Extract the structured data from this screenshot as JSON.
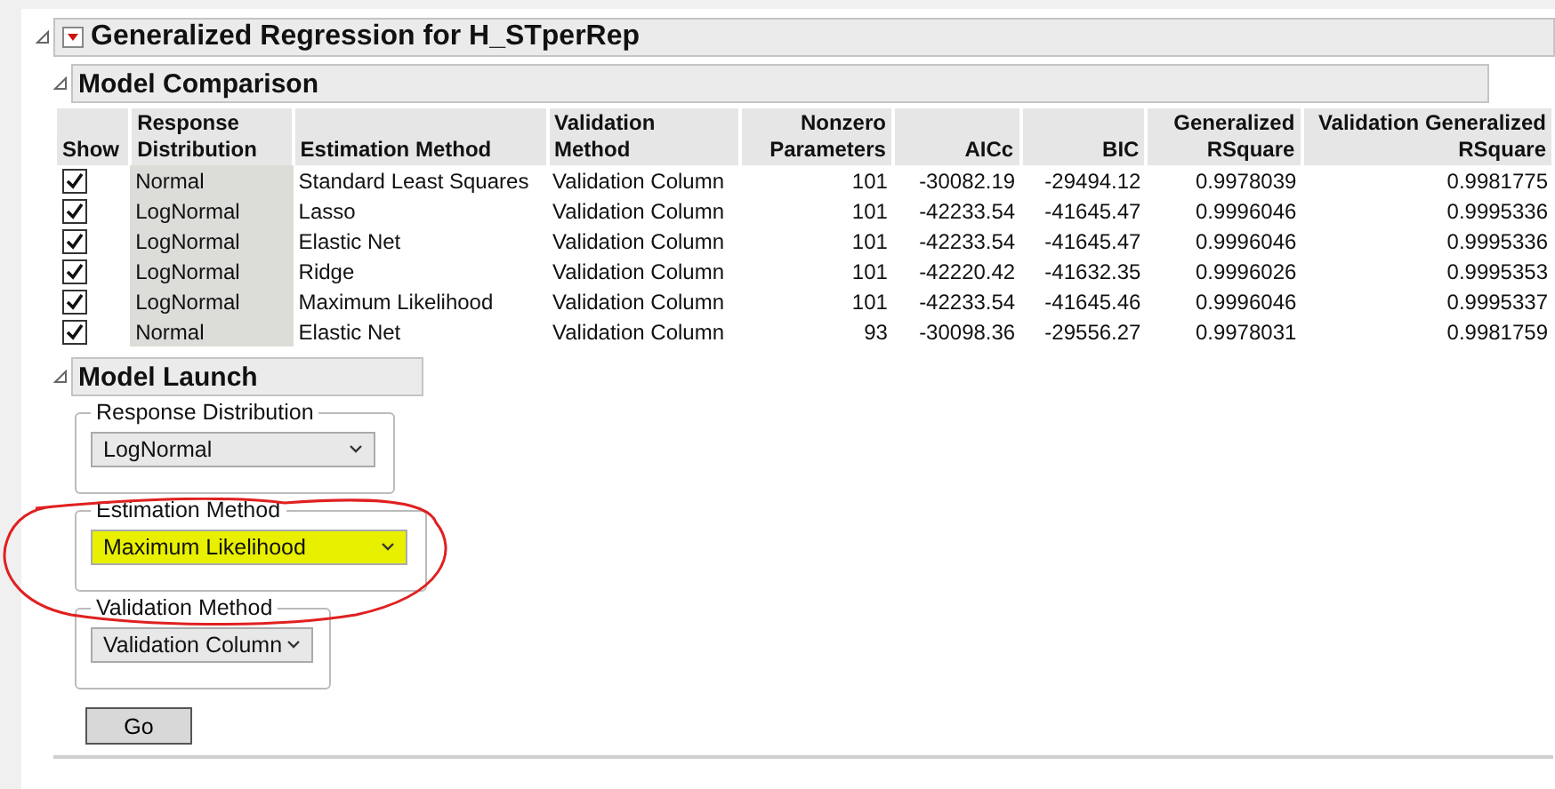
{
  "report": {
    "title": "Generalized Regression for H_STperRep"
  },
  "model_comparison": {
    "title": "Model Comparison",
    "show_header": "Show",
    "columns": [
      "Response Distribution",
      "Estimation Method",
      "Validation Method",
      "Nonzero Parameters",
      "AICc",
      "BIC",
      "Generalized RSquare",
      "Validation Generalized RSquare"
    ],
    "rows": [
      {
        "checked": true,
        "cells": [
          "Normal",
          "Standard Least Squares",
          "Validation Column",
          "101",
          "-30082.19",
          "-29494.12",
          "0.9978039",
          "0.9981775"
        ]
      },
      {
        "checked": true,
        "cells": [
          "LogNormal",
          "Lasso",
          "Validation Column",
          "101",
          "-42233.54",
          "-41645.47",
          "0.9996046",
          "0.9995336"
        ]
      },
      {
        "checked": true,
        "cells": [
          "LogNormal",
          "Elastic Net",
          "Validation Column",
          "101",
          "-42233.54",
          "-41645.47",
          "0.9996046",
          "0.9995336"
        ]
      },
      {
        "checked": true,
        "cells": [
          "LogNormal",
          "Ridge",
          "Validation Column",
          "101",
          "-42220.42",
          "-41632.35",
          "0.9996026",
          "0.9995353"
        ]
      },
      {
        "checked": true,
        "cells": [
          "LogNormal",
          "Maximum Likelihood",
          "Validation Column",
          "101",
          "-42233.54",
          "-41645.46",
          "0.9996046",
          "0.9995337"
        ]
      },
      {
        "checked": true,
        "cells": [
          "Normal",
          "Elastic Net",
          "Validation Column",
          "93",
          "-30098.36",
          "-29556.27",
          "0.9978031",
          "0.9981759"
        ]
      }
    ]
  },
  "model_launch": {
    "title": "Model Launch",
    "groups": [
      {
        "label": "Response Distribution",
        "value": "LogNormal",
        "highlighted": false
      },
      {
        "label": "Estimation Method",
        "value": "Maximum Likelihood",
        "highlighted": true
      },
      {
        "label": "Validation Method",
        "value": "Validation Column",
        "highlighted": false
      }
    ],
    "button": "Go"
  }
}
